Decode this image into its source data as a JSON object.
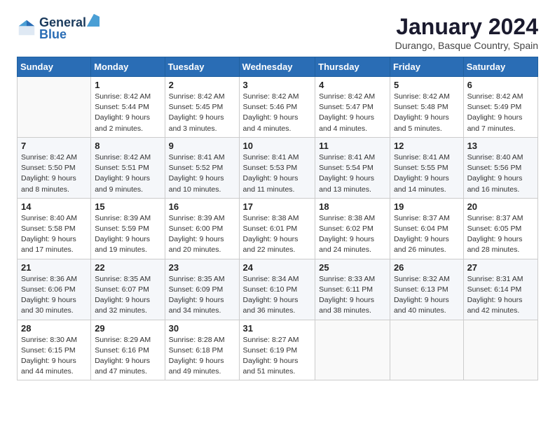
{
  "header": {
    "logo_line1": "General",
    "logo_line2": "Blue",
    "month_title": "January 2024",
    "subtitle": "Durango, Basque Country, Spain"
  },
  "weekdays": [
    "Sunday",
    "Monday",
    "Tuesday",
    "Wednesday",
    "Thursday",
    "Friday",
    "Saturday"
  ],
  "weeks": [
    [
      {
        "num": "",
        "sunrise": "",
        "sunset": "",
        "daylight": ""
      },
      {
        "num": "1",
        "sunrise": "Sunrise: 8:42 AM",
        "sunset": "Sunset: 5:44 PM",
        "daylight": "Daylight: 9 hours and 2 minutes."
      },
      {
        "num": "2",
        "sunrise": "Sunrise: 8:42 AM",
        "sunset": "Sunset: 5:45 PM",
        "daylight": "Daylight: 9 hours and 3 minutes."
      },
      {
        "num": "3",
        "sunrise": "Sunrise: 8:42 AM",
        "sunset": "Sunset: 5:46 PM",
        "daylight": "Daylight: 9 hours and 4 minutes."
      },
      {
        "num": "4",
        "sunrise": "Sunrise: 8:42 AM",
        "sunset": "Sunset: 5:47 PM",
        "daylight": "Daylight: 9 hours and 4 minutes."
      },
      {
        "num": "5",
        "sunrise": "Sunrise: 8:42 AM",
        "sunset": "Sunset: 5:48 PM",
        "daylight": "Daylight: 9 hours and 5 minutes."
      },
      {
        "num": "6",
        "sunrise": "Sunrise: 8:42 AM",
        "sunset": "Sunset: 5:49 PM",
        "daylight": "Daylight: 9 hours and 7 minutes."
      }
    ],
    [
      {
        "num": "7",
        "sunrise": "Sunrise: 8:42 AM",
        "sunset": "Sunset: 5:50 PM",
        "daylight": "Daylight: 9 hours and 8 minutes."
      },
      {
        "num": "8",
        "sunrise": "Sunrise: 8:42 AM",
        "sunset": "Sunset: 5:51 PM",
        "daylight": "Daylight: 9 hours and 9 minutes."
      },
      {
        "num": "9",
        "sunrise": "Sunrise: 8:41 AM",
        "sunset": "Sunset: 5:52 PM",
        "daylight": "Daylight: 9 hours and 10 minutes."
      },
      {
        "num": "10",
        "sunrise": "Sunrise: 8:41 AM",
        "sunset": "Sunset: 5:53 PM",
        "daylight": "Daylight: 9 hours and 11 minutes."
      },
      {
        "num": "11",
        "sunrise": "Sunrise: 8:41 AM",
        "sunset": "Sunset: 5:54 PM",
        "daylight": "Daylight: 9 hours and 13 minutes."
      },
      {
        "num": "12",
        "sunrise": "Sunrise: 8:41 AM",
        "sunset": "Sunset: 5:55 PM",
        "daylight": "Daylight: 9 hours and 14 minutes."
      },
      {
        "num": "13",
        "sunrise": "Sunrise: 8:40 AM",
        "sunset": "Sunset: 5:56 PM",
        "daylight": "Daylight: 9 hours and 16 minutes."
      }
    ],
    [
      {
        "num": "14",
        "sunrise": "Sunrise: 8:40 AM",
        "sunset": "Sunset: 5:58 PM",
        "daylight": "Daylight: 9 hours and 17 minutes."
      },
      {
        "num": "15",
        "sunrise": "Sunrise: 8:39 AM",
        "sunset": "Sunset: 5:59 PM",
        "daylight": "Daylight: 9 hours and 19 minutes."
      },
      {
        "num": "16",
        "sunrise": "Sunrise: 8:39 AM",
        "sunset": "Sunset: 6:00 PM",
        "daylight": "Daylight: 9 hours and 20 minutes."
      },
      {
        "num": "17",
        "sunrise": "Sunrise: 8:38 AM",
        "sunset": "Sunset: 6:01 PM",
        "daylight": "Daylight: 9 hours and 22 minutes."
      },
      {
        "num": "18",
        "sunrise": "Sunrise: 8:38 AM",
        "sunset": "Sunset: 6:02 PM",
        "daylight": "Daylight: 9 hours and 24 minutes."
      },
      {
        "num": "19",
        "sunrise": "Sunrise: 8:37 AM",
        "sunset": "Sunset: 6:04 PM",
        "daylight": "Daylight: 9 hours and 26 minutes."
      },
      {
        "num": "20",
        "sunrise": "Sunrise: 8:37 AM",
        "sunset": "Sunset: 6:05 PM",
        "daylight": "Daylight: 9 hours and 28 minutes."
      }
    ],
    [
      {
        "num": "21",
        "sunrise": "Sunrise: 8:36 AM",
        "sunset": "Sunset: 6:06 PM",
        "daylight": "Daylight: 9 hours and 30 minutes."
      },
      {
        "num": "22",
        "sunrise": "Sunrise: 8:35 AM",
        "sunset": "Sunset: 6:07 PM",
        "daylight": "Daylight: 9 hours and 32 minutes."
      },
      {
        "num": "23",
        "sunrise": "Sunrise: 8:35 AM",
        "sunset": "Sunset: 6:09 PM",
        "daylight": "Daylight: 9 hours and 34 minutes."
      },
      {
        "num": "24",
        "sunrise": "Sunrise: 8:34 AM",
        "sunset": "Sunset: 6:10 PM",
        "daylight": "Daylight: 9 hours and 36 minutes."
      },
      {
        "num": "25",
        "sunrise": "Sunrise: 8:33 AM",
        "sunset": "Sunset: 6:11 PM",
        "daylight": "Daylight: 9 hours and 38 minutes."
      },
      {
        "num": "26",
        "sunrise": "Sunrise: 8:32 AM",
        "sunset": "Sunset: 6:13 PM",
        "daylight": "Daylight: 9 hours and 40 minutes."
      },
      {
        "num": "27",
        "sunrise": "Sunrise: 8:31 AM",
        "sunset": "Sunset: 6:14 PM",
        "daylight": "Daylight: 9 hours and 42 minutes."
      }
    ],
    [
      {
        "num": "28",
        "sunrise": "Sunrise: 8:30 AM",
        "sunset": "Sunset: 6:15 PM",
        "daylight": "Daylight: 9 hours and 44 minutes."
      },
      {
        "num": "29",
        "sunrise": "Sunrise: 8:29 AM",
        "sunset": "Sunset: 6:16 PM",
        "daylight": "Daylight: 9 hours and 47 minutes."
      },
      {
        "num": "30",
        "sunrise": "Sunrise: 8:28 AM",
        "sunset": "Sunset: 6:18 PM",
        "daylight": "Daylight: 9 hours and 49 minutes."
      },
      {
        "num": "31",
        "sunrise": "Sunrise: 8:27 AM",
        "sunset": "Sunset: 6:19 PM",
        "daylight": "Daylight: 9 hours and 51 minutes."
      },
      {
        "num": "",
        "sunrise": "",
        "sunset": "",
        "daylight": ""
      },
      {
        "num": "",
        "sunrise": "",
        "sunset": "",
        "daylight": ""
      },
      {
        "num": "",
        "sunrise": "",
        "sunset": "",
        "daylight": ""
      }
    ]
  ]
}
